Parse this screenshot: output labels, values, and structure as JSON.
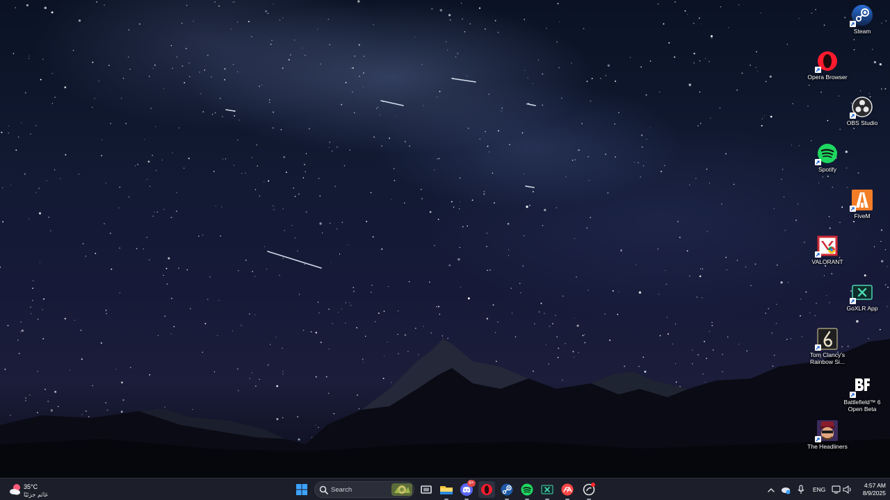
{
  "desktop_icons": [
    {
      "key": "steam",
      "label": "Steam"
    },
    {
      "key": "opera",
      "label": "Opera Browser"
    },
    {
      "key": "obs",
      "label": "OBS Studio"
    },
    {
      "key": "spotify",
      "label": "Spotify"
    },
    {
      "key": "fivem",
      "label": "FiveM"
    },
    {
      "key": "valorant",
      "label": "VALORANT"
    },
    {
      "key": "goxlr",
      "label": "GoXLR App"
    },
    {
      "key": "rainbow",
      "label": "Tom Clancy's Rainbow Si..."
    },
    {
      "key": "battlefield",
      "label": "Battlefield™ 6 Open Beta"
    },
    {
      "key": "headliners",
      "label": "The Headliners"
    }
  ],
  "taskbar": {
    "weather": {
      "temp": "35°C",
      "condition": "غائم جزئيًا",
      "icon": "partly-cloudy-icon"
    },
    "search": {
      "placeholder": "Search"
    },
    "discord_badge": "9+",
    "language": "ENG",
    "clock": {
      "time": "4:57 AM",
      "date": "8/9/2025"
    }
  },
  "colors": {
    "taskbar_bg": "#1c1f29",
    "windows_blue": "#3ba3ff",
    "spotify_green": "#1ed760",
    "opera_red": "#ff1b2d"
  }
}
